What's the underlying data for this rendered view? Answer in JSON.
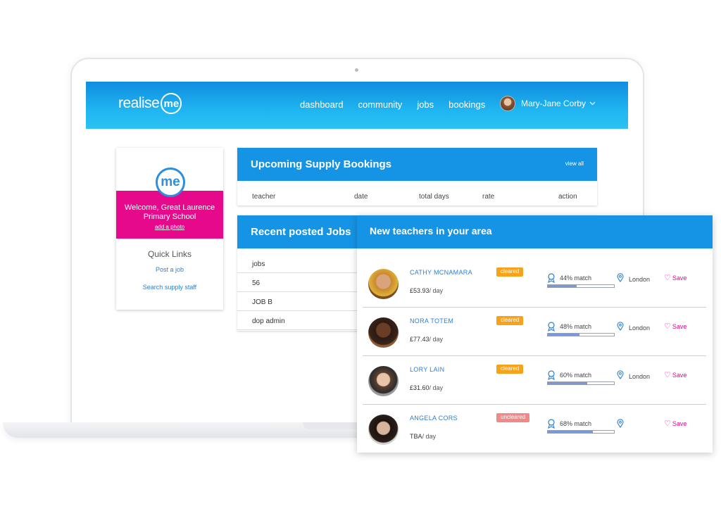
{
  "brand": {
    "name": "realise",
    "badge": "me"
  },
  "nav": [
    "dashboard",
    "community",
    "jobs",
    "bookings"
  ],
  "user": {
    "name": "Mary-Jane Corby"
  },
  "welcome": {
    "badge": "me",
    "title": "Welcome, Great Laurence Primary School",
    "add_photo": "add a photo",
    "quick_links_title": "Quick Links",
    "links": [
      "Post a job",
      "Search supply staff"
    ]
  },
  "bookings": {
    "title": "Upcoming Supply Bookings",
    "view_all": "view all",
    "columns": [
      "teacher",
      "date",
      "total days",
      "rate",
      "action"
    ]
  },
  "jobs": {
    "title": "Recent posted Jobs",
    "rows": [
      "jobs",
      "56",
      "JOB B",
      "dop admin"
    ]
  },
  "teachers": {
    "title": "New teachers in your area",
    "save_label": "Save",
    "items": [
      {
        "name": "CATHY MCNAMARA",
        "rate": "£53.93",
        "unit": "/ day",
        "status": "cleared",
        "match_text": "44% match",
        "match": 0.44,
        "location": "London"
      },
      {
        "name": "NORA TOTEM",
        "rate": "£77.43",
        "unit": "/ day",
        "status": "cleared",
        "match_text": "48% match",
        "match": 0.48,
        "location": "London"
      },
      {
        "name": "LORY LAIN",
        "rate": "£31.60",
        "unit": "/ day",
        "status": "cleared",
        "match_text": "60% match",
        "match": 0.6,
        "location": "London"
      },
      {
        "name": "ANGELA CORS",
        "rate": "TBA",
        "unit": "/ day",
        "status": "uncleared",
        "match_text": "68% match",
        "match": 0.68,
        "location": ""
      }
    ]
  },
  "colors": {
    "primary": "#1594e6",
    "pink": "#e7098c",
    "cleared": "#f5a31a",
    "uncleared": "#f08a8a",
    "match_bar": "#7c97d6"
  }
}
